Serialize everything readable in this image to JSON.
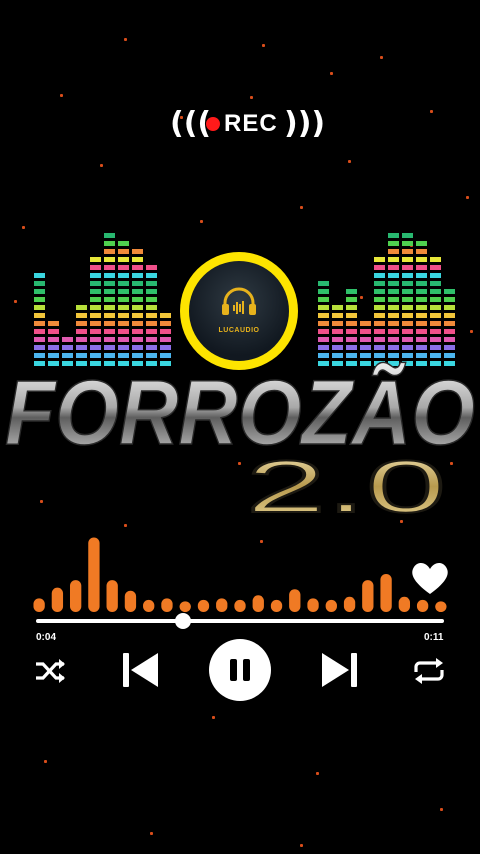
{
  "rec_badge": {
    "label": "REC",
    "left_wave": "(((",
    "right_wave": ")))",
    "dot_color": "#ff1a1a"
  },
  "logo": {
    "icon": "headphones-icon",
    "text": "LUCAUDIO",
    "ring_color": "#fde400"
  },
  "title": {
    "main": "FORROZÃO",
    "version": "2.0"
  },
  "player": {
    "current_time": "0:04",
    "total_time": "0:11",
    "progress": 0.36,
    "is_playing": true,
    "liked": true,
    "controls": [
      "shuffle-icon",
      "previous-icon",
      "pause-icon",
      "next-icon",
      "repeat-icon"
    ],
    "accent_color": "#f07a24",
    "visualizer_levels": [
      0.18,
      0.32,
      0.42,
      0.98,
      0.42,
      0.28,
      0.16,
      0.18,
      0.14,
      0.16,
      0.18,
      0.16,
      0.22,
      0.16,
      0.3,
      0.18,
      0.16,
      0.2,
      0.42,
      0.5,
      0.2,
      0.16,
      0.14
    ]
  }
}
